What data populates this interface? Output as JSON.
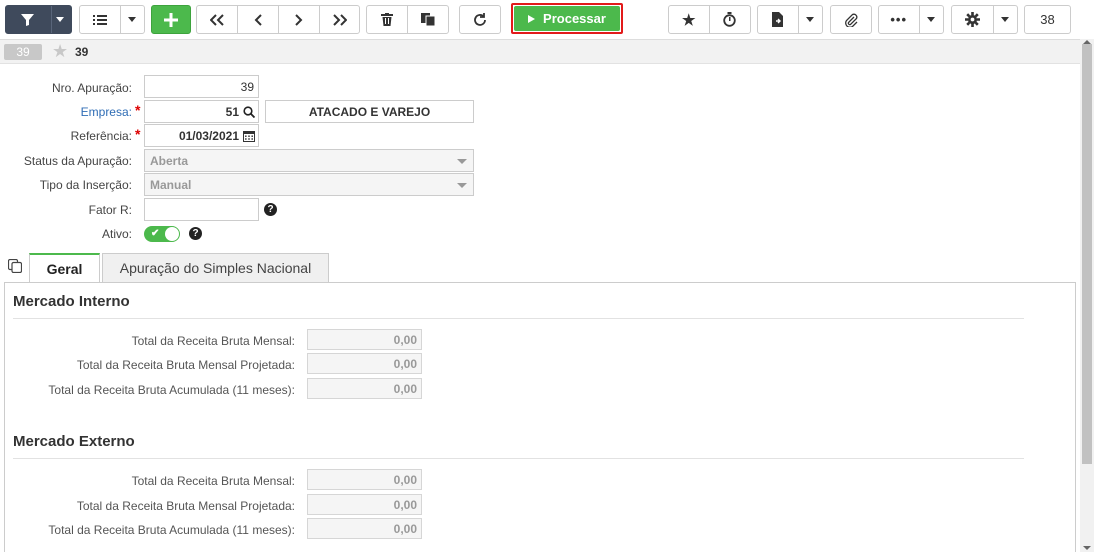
{
  "toolbar": {
    "processar_label": "Processar",
    "record_counter": "38"
  },
  "record_bar": {
    "badge": "39",
    "id_label": "39"
  },
  "form": {
    "nro_apuracao": {
      "label": "Nro. Apuração:",
      "value": "39"
    },
    "empresa": {
      "label": "Empresa:",
      "value": "51",
      "name": "ATACADO E VAREJO",
      "required": "*"
    },
    "referencia": {
      "label": "Referência:",
      "value": "01/03/2021",
      "required": "*"
    },
    "status_apuracao": {
      "label": "Status da Apuração:",
      "value": "Aberta"
    },
    "tipo_insercao": {
      "label": "Tipo da Inserção:",
      "value": "Manual"
    },
    "fator_r": {
      "label": "Fator R:",
      "value": ""
    },
    "ativo": {
      "label": "Ativo:",
      "checked": true
    }
  },
  "tabs": [
    {
      "label": "Geral",
      "active": true
    },
    {
      "label": "Apuração do Simples Nacional",
      "active": false
    }
  ],
  "sections": [
    {
      "title": "Mercado Interno",
      "rows": [
        {
          "label": "Total da Receita Bruta Mensal:",
          "value": "0,00"
        },
        {
          "label": "Total da Receita Bruta Mensal Projetada:",
          "value": "0,00"
        },
        {
          "label": "Total da Receita Bruta Acumulada (11 meses):",
          "value": "0,00"
        }
      ]
    },
    {
      "title": "Mercado Externo",
      "rows": [
        {
          "label": "Total da Receita Bruta Mensal:",
          "value": "0,00"
        },
        {
          "label": "Total da Receita Bruta Mensal Projetada:",
          "value": "0,00"
        },
        {
          "label": "Total da Receita Bruta Acumulada (11 meses):",
          "value": "0,00"
        }
      ]
    }
  ],
  "colors": {
    "accent_green": "#4cb94c",
    "highlight_red": "#e21a1a",
    "toolbar_dark": "#3f4a5c",
    "link_blue": "#2f6db5"
  },
  "icons": [
    "filter-icon",
    "list-icon",
    "plus-icon",
    "first-page-icon",
    "prev-icon",
    "next-icon",
    "last-page-icon",
    "trash-icon",
    "copy-icon",
    "refresh-icon",
    "play-icon",
    "star-icon",
    "stopwatch-icon",
    "export-file-icon",
    "paperclip-icon",
    "more-icon",
    "gear-icon",
    "search-icon",
    "calendar-icon",
    "help-icon"
  ]
}
